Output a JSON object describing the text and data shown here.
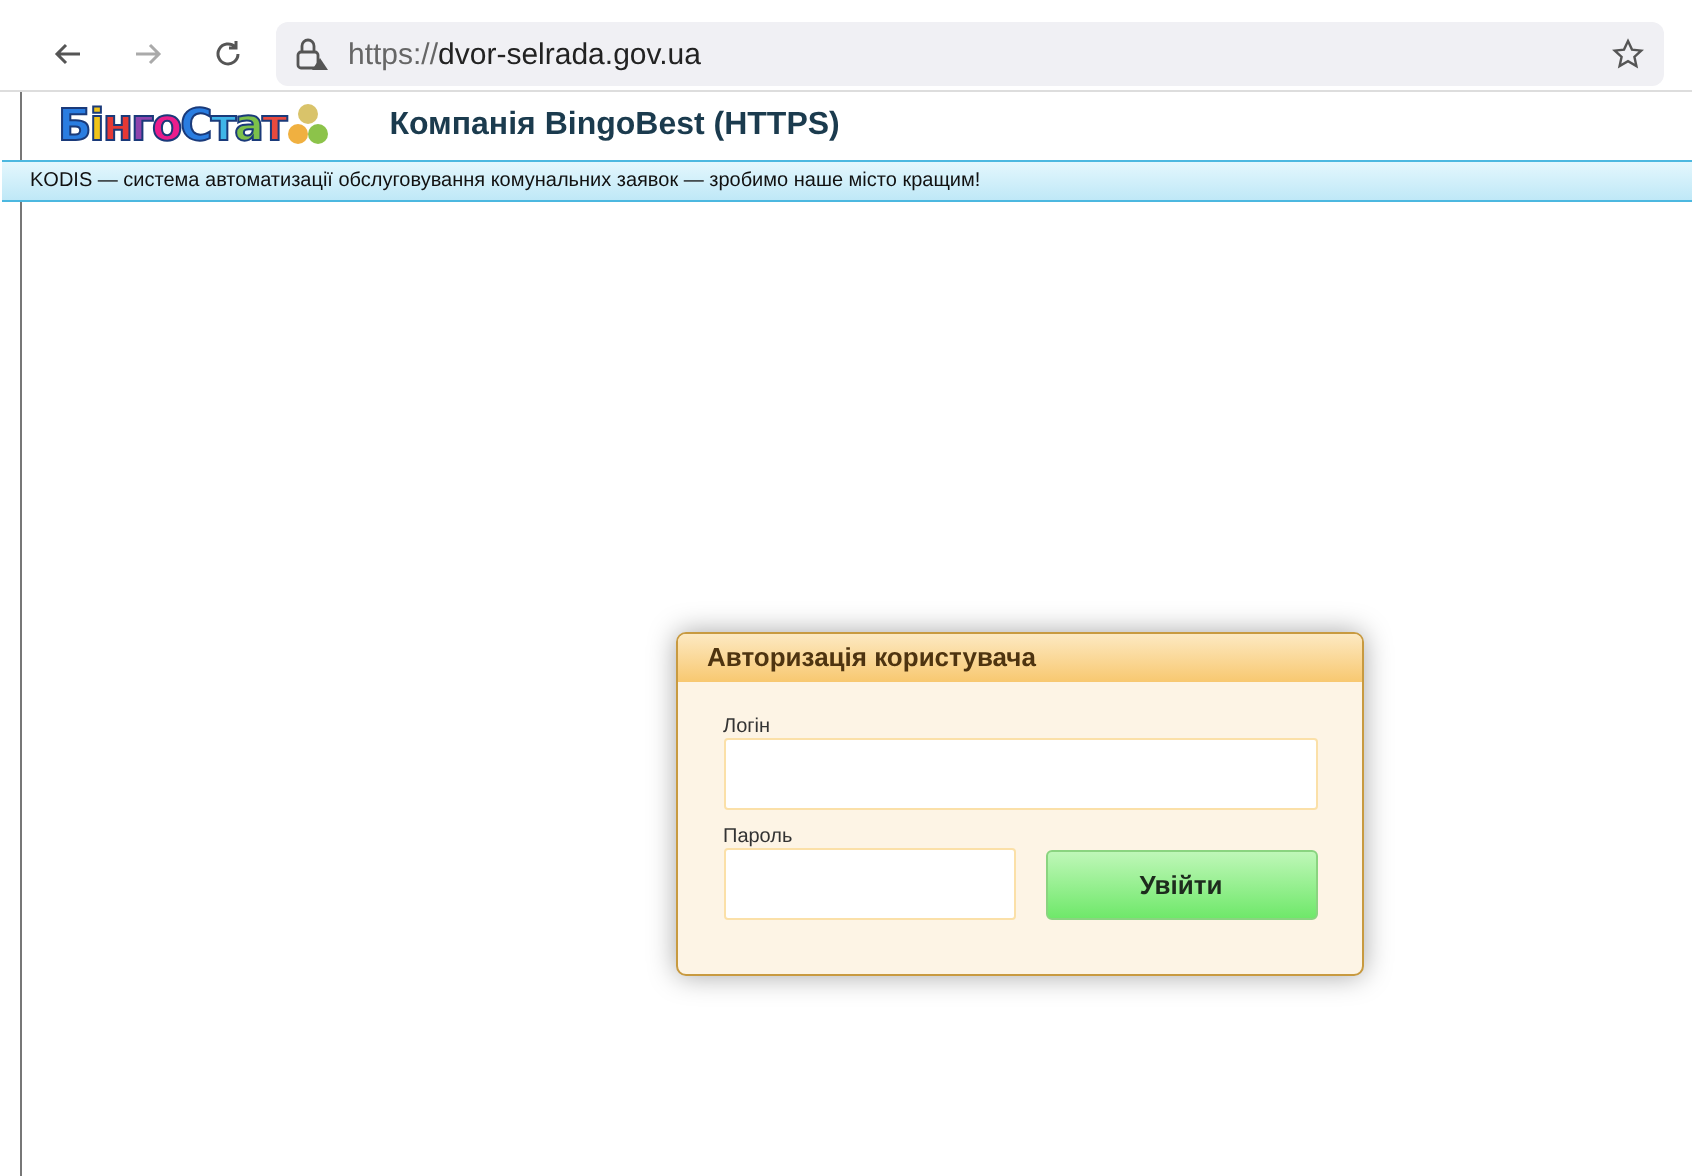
{
  "browser": {
    "url_scheme": "https://",
    "url_host": "dvor-selrada.gov.ua"
  },
  "header": {
    "logo": "БінгоСтат",
    "title": "Компанія BingoBest (HTTPS)"
  },
  "banner": "KODIS — система автоматизації обслуговування комунальних заявок — зробимо наше місто кращим!",
  "login": {
    "title": "Авторизація користувача",
    "login_label": "Логін",
    "password_label": "Пароль",
    "submit": "Увійти"
  }
}
